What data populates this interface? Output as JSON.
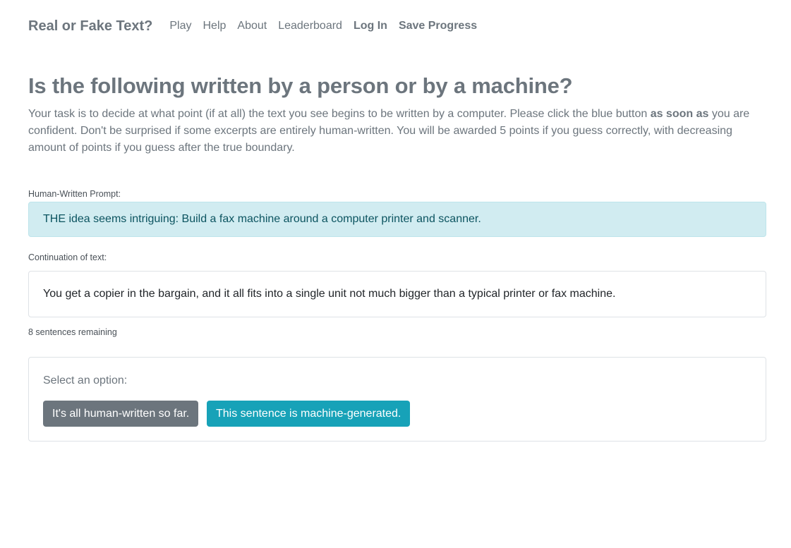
{
  "navbar": {
    "brand": "Real or Fake Text?",
    "links": [
      {
        "label": "Play"
      },
      {
        "label": "Help"
      },
      {
        "label": "About"
      },
      {
        "label": "Leaderboard"
      },
      {
        "label": "Log In"
      },
      {
        "label": "Save Progress"
      }
    ]
  },
  "main": {
    "title": "Is the following written by a person or by a machine?",
    "intro": {
      "part1": "Your task is to decide at what point (if at all) the text you see begins to be written by a computer. Please click the blue button ",
      "emphasis": "as soon as",
      "part2": " you are confident. Don't be surprised if some excerpts are entirely human-written. You will be awarded 5 points if you guess correctly, with decreasing amount of points if you guess after the true boundary."
    },
    "prompt_label": "Human-Written Prompt:",
    "prompt_text": "THE idea seems intriguing: Build a fax machine around a computer printer and scanner.",
    "continuation_label": "Continuation of text:",
    "continuation_text": "You get a copier in the bargain, and it all fits into a single unit not much bigger than a typical printer or fax machine.",
    "remaining": "8 sentences remaining",
    "options": {
      "label": "Select an option:",
      "human_button": "It's all human-written so far.",
      "machine_button": "This sentence is machine-generated."
    }
  },
  "colors": {
    "text_muted": "#6c757d",
    "prompt_bg": "#d1ecf1",
    "prompt_text": "#0c5460",
    "button_secondary": "#6c757d",
    "button_info": "#17a2b8"
  }
}
